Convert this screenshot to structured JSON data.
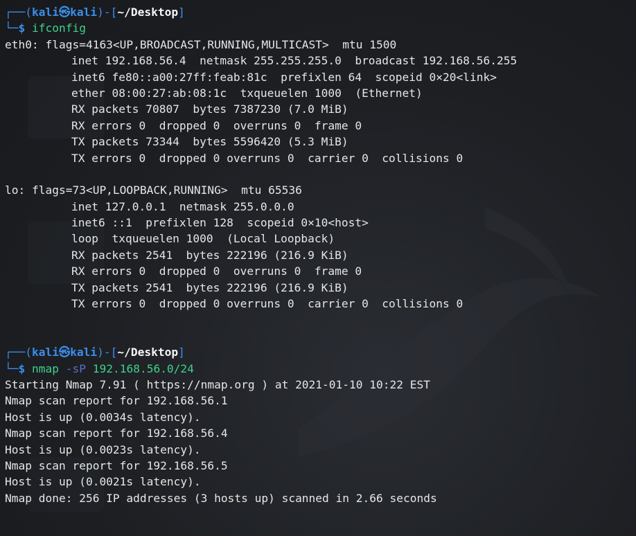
{
  "prompt1": {
    "corner_top": "┌──(",
    "user": "kali",
    "at": "㉿",
    "host": "kali",
    "mid": ")-[",
    "path": "~/Desktop",
    "close": "]",
    "corner_bottom": "└─",
    "dollar": "$",
    "command": "ifconfig"
  },
  "eth0": {
    "header": "eth0: flags=4163<UP,BROADCAST,RUNNING,MULTICAST>  mtu 1500",
    "lines": [
      "inet 192.168.56.4  netmask 255.255.255.0  broadcast 192.168.56.255",
      "inet6 fe80::a00:27ff:feab:81c  prefixlen 64  scopeid 0×20<link>",
      "ether 08:00:27:ab:08:1c  txqueuelen 1000  (Ethernet)",
      "RX packets 70807  bytes 7387230 (7.0 MiB)",
      "RX errors 0  dropped 0  overruns 0  frame 0",
      "TX packets 73344  bytes 5596420 (5.3 MiB)",
      "TX errors 0  dropped 0 overruns 0  carrier 0  collisions 0"
    ]
  },
  "lo": {
    "header": "lo: flags=73<UP,LOOPBACK,RUNNING>  mtu 65536",
    "lines": [
      "inet 127.0.0.1  netmask 255.0.0.0",
      "inet6 ::1  prefixlen 128  scopeid 0×10<host>",
      "loop  txqueuelen 1000  (Local Loopback)",
      "RX packets 2541  bytes 222196 (216.9 KiB)",
      "RX errors 0  dropped 0  overruns 0  frame 0",
      "TX packets 2541  bytes 222196 (216.9 KiB)",
      "TX errors 0  dropped 0 overruns 0  carrier 0  collisions 0"
    ]
  },
  "prompt2": {
    "corner_top": "┌──(",
    "user": "kali",
    "at": "㉿",
    "host": "kali",
    "mid": ")-[",
    "path": "~/Desktop",
    "close": "]",
    "corner_bottom": "└─",
    "dollar": "$",
    "command": "nmap",
    "flag": "-sP",
    "arg": "192.168.56.0/24"
  },
  "nmap_output": [
    "Starting Nmap 7.91 ( https://nmap.org ) at 2021-01-10 10:22 EST",
    "Nmap scan report for 192.168.56.1",
    "Host is up (0.0034s latency).",
    "Nmap scan report for 192.168.56.4",
    "Host is up (0.0023s latency).",
    "Nmap scan report for 192.168.56.5",
    "Host is up (0.0021s latency).",
    "Nmap done: 256 IP addresses (3 hosts up) scanned in 2.66 seconds"
  ],
  "colors": {
    "background": "#1f2125",
    "prompt_blue": "#3b8eea",
    "command_green": "#3fd18a",
    "text": "#e6e6e6"
  }
}
